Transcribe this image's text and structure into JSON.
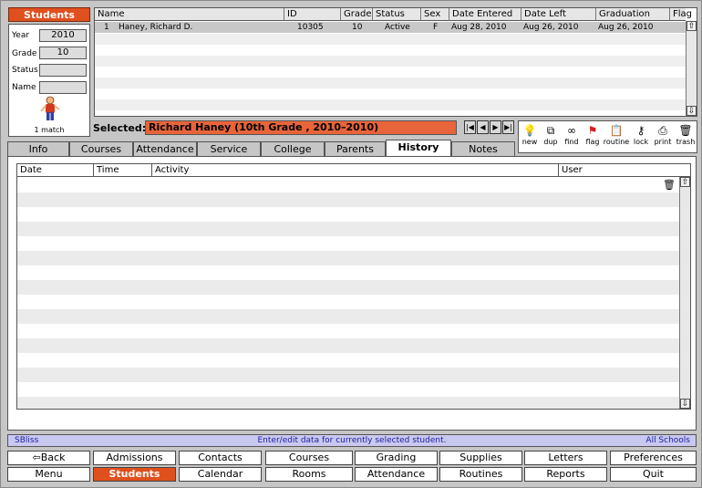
{
  "search_panel": {
    "title": "Students",
    "fields": [
      {
        "label": "Year",
        "value": "2010"
      },
      {
        "label": "Grade",
        "value": "10"
      },
      {
        "label": "Status",
        "value": ""
      },
      {
        "label": "Name",
        "value": ""
      }
    ],
    "match_count": "1 match"
  },
  "student_list": {
    "columns": [
      "Name",
      "ID",
      "Grade",
      "Status",
      "Sex",
      "Date Entered",
      "Date Left",
      "Graduation",
      "Flag"
    ],
    "rows": [
      {
        "num": "1",
        "name": "Haney, Richard D.",
        "id": "10305",
        "grade": "10",
        "status": "Active",
        "sex": "F",
        "date_entered": "Aug 28, 2010",
        "date_left": "Aug 26, 2010",
        "graduation": "Aug 26, 2010"
      }
    ]
  },
  "selected": {
    "label": "Selected:",
    "value": "Richard Haney (10th Grade , 2010–2010)"
  },
  "toolbar": [
    {
      "label": "new",
      "icon": "lightbulb-icon"
    },
    {
      "label": "dup",
      "icon": "duplicate-icon"
    },
    {
      "label": "find",
      "icon": "glasses-icon"
    },
    {
      "label": "flag",
      "icon": "flag-icon"
    },
    {
      "label": "routine",
      "icon": "clipboard-icon"
    },
    {
      "label": "lock",
      "icon": "key-icon"
    },
    {
      "label": "print",
      "icon": "printer-icon"
    },
    {
      "label": "trash",
      "icon": "trash-icon"
    }
  ],
  "tabs": [
    "Info",
    "Courses",
    "Attendance",
    "Service",
    "College",
    "Parents",
    "History",
    "Notes"
  ],
  "active_tab": "History",
  "history": {
    "columns": [
      "Date",
      "Time",
      "Activity",
      "User"
    ]
  },
  "status_bar": {
    "left": "SBliss",
    "center": "Enter/edit data for currently selected student.",
    "right": "All Schools"
  },
  "bottom_nav": {
    "row1": [
      "Back",
      "Admissions",
      "Contacts",
      "Courses",
      "Grading",
      "Supplies",
      "Letters",
      "Preferences"
    ],
    "row2": [
      "Menu",
      "Students",
      "Calendar",
      "Rooms",
      "Attendance",
      "Routines",
      "Reports",
      "Quit"
    ],
    "active": "Students"
  },
  "colors": {
    "accent": "#e0501e",
    "selected_field": "#e8643a",
    "status_bar": "#c8c8f0"
  }
}
